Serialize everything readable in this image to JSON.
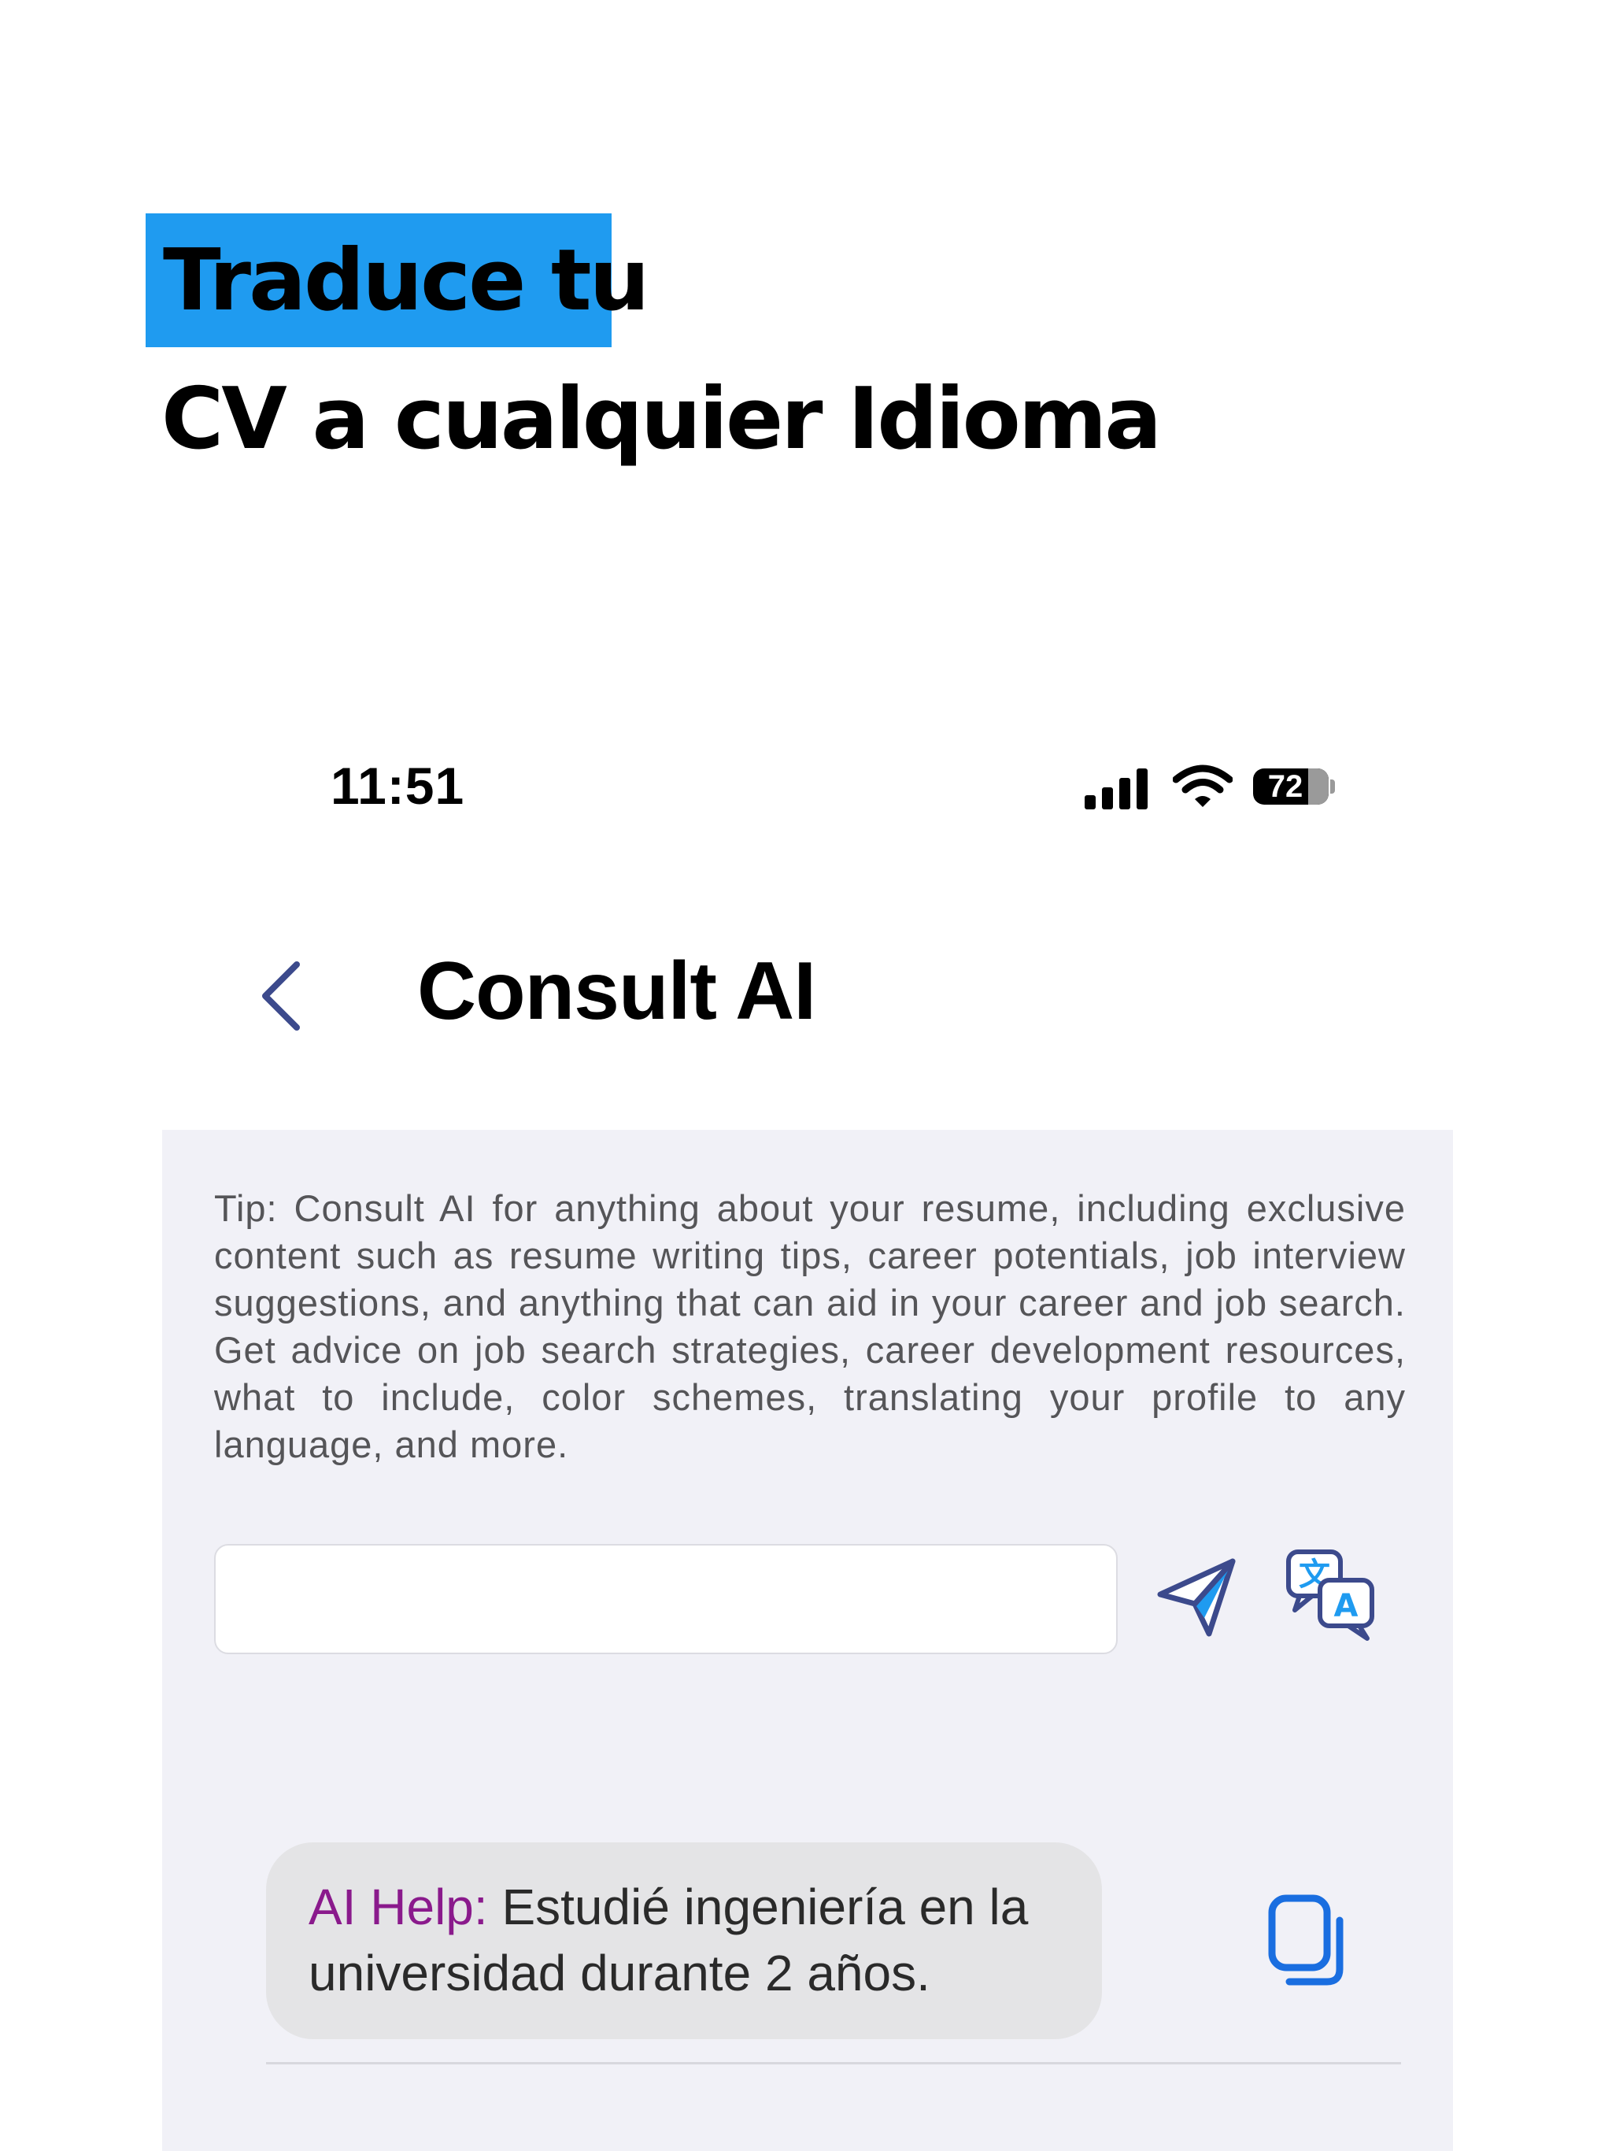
{
  "promo": {
    "headline_line1": "Traduce tu",
    "headline_line2": "CV a cualquier Idioma"
  },
  "status_bar": {
    "time": "11:51",
    "battery_level": "72"
  },
  "nav": {
    "title": "Consult AI"
  },
  "tip": {
    "text": "Tip: Consult AI for anything about your resume, including exclusive content such as resume writing tips, career potentials, job interview suggestions, and anything that can aid in your career and job search. Get advice on job search strategies, career development resources, what to include, color schemes, translating your profile to any language, and more."
  },
  "input": {
    "value": "",
    "placeholder": ""
  },
  "chat": {
    "label": "AI Help:",
    "message": " Estudié ingeniería en la universidad durante 2 años."
  },
  "colors": {
    "accent_blue": "#1f9bf0",
    "ai_label": "#8a1a8c",
    "icon_navy": "#3c4a8c",
    "copy_blue": "#1a6ee0"
  },
  "icons": {
    "back": "chevron-left-icon",
    "send": "paper-plane-icon",
    "translate": "translate-icon",
    "copy": "copy-icon",
    "signal": "cellular-signal-icon",
    "wifi": "wifi-icon",
    "battery": "battery-icon"
  }
}
